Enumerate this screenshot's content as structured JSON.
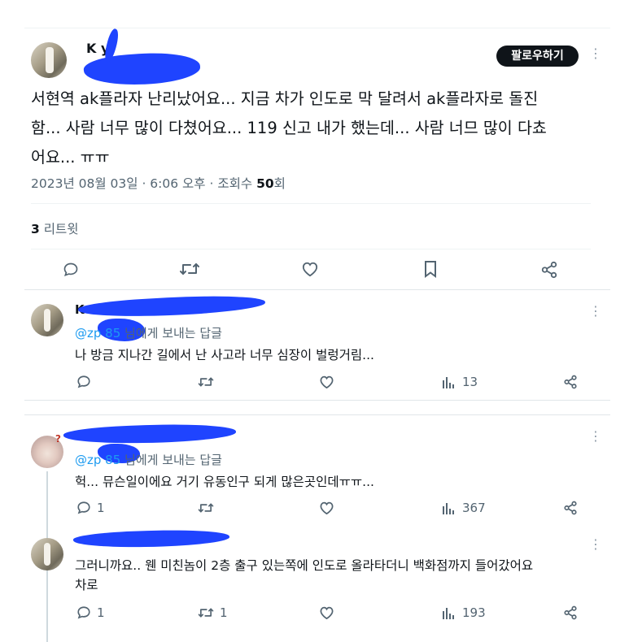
{
  "main_tweet": {
    "author_name": "K   y",
    "follow_label": "팔로우하기",
    "text_line1": "서현역 ak플라자 난리났어요... 지금 차가 인도로 막 달려서 ak플라자로 돌진",
    "text_line2": "함... 사람 너무 많이 다쳤어요... 119 신고 내가 했는데... 사람 너므 많이 다쵸",
    "text_line3": "어요... ㅠㅠ",
    "timestamp": "2023년 08월 03일 · 6:06 오후 · 조회수",
    "views": "50",
    "views_suffix": "회",
    "retweet_count": "3",
    "retweet_label": "리트윗"
  },
  "replies": [
    {
      "author_name": "K",
      "reply_to_handle": "@zp     85",
      "reply_to_suffix": "님에게 보내는 답글",
      "text": "나 방금 지나간 길에서 난 사고라 너무 심장이 벌렁거림...",
      "reply_count": "",
      "retweet_count": "",
      "views": "13"
    },
    {
      "author_name": "",
      "reply_to_handle": "@zp     85",
      "reply_to_suffix": "님에게 보내는 답글",
      "text": "헉... 뮤슨일이에요 거기 유동인구 되게 많은곳인데ㅠㅠ...",
      "reply_count": "1",
      "retweet_count": "",
      "views": "367"
    },
    {
      "author_name": "",
      "reply_to_handle": "",
      "reply_to_suffix": "",
      "text_line1": "그러니까요.. 웬 미친놈이 2층 출구 있는쪽에 인도로 올라타더니 백화점까지 들어갔어요",
      "text_line2": "차로",
      "reply_count": "1",
      "retweet_count": "1",
      "views": "193"
    }
  ],
  "icons": {
    "reply": "speech-bubble-icon",
    "retweet": "retweet-icon",
    "like": "heart-icon",
    "bookmark": "bookmark-icon",
    "share": "share-icon",
    "views": "bar-chart-icon",
    "more": "more-dots-icon"
  },
  "colors": {
    "text": "#0f1419",
    "muted": "#536471",
    "link": "#1d9bf0",
    "redaction": "#1f44ff",
    "follow_bg": "#0f1419"
  }
}
